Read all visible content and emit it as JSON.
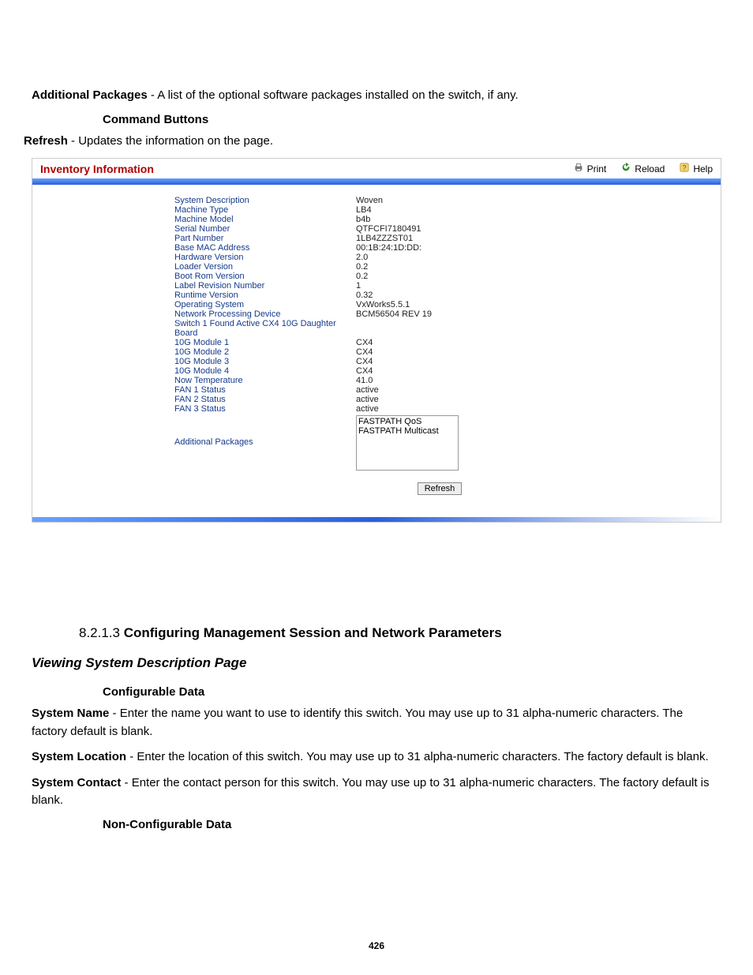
{
  "intro": {
    "additional_packages_bold": "Additional Packages",
    "additional_packages_text": " - A list of the optional software packages installed on the switch, if any.",
    "command_buttons": "Command Buttons",
    "refresh_bold": "Refresh",
    "refresh_text": " - Updates the information on the page."
  },
  "panel": {
    "title": "Inventory Information",
    "actions": {
      "print": "Print",
      "reload": "Reload",
      "help": "Help"
    },
    "rows": [
      {
        "label": "System Description",
        "value": "Woven"
      },
      {
        "label": "Machine Type",
        "value": "LB4"
      },
      {
        "label": "Machine Model",
        "value": "b4b"
      },
      {
        "label": "Serial Number",
        "value": "QTFCFI7180491"
      },
      {
        "label": "Part Number",
        "value": "1LB4ZZZST01"
      },
      {
        "label": "Base MAC Address",
        "value": "00:1B:24:1D:DD:"
      },
      {
        "label": "Hardware Version",
        "value": "2.0"
      },
      {
        "label": "Loader Version",
        "value": "0.2"
      },
      {
        "label": "Boot Rom Version",
        "value": "0.2"
      },
      {
        "label": "Label Revision Number",
        "value": "1"
      },
      {
        "label": "Runtime Version",
        "value": "0.32"
      },
      {
        "label": "Operating System",
        "value": "VxWorks5.5.1"
      },
      {
        "label": "Network Processing Device",
        "value": "BCM56504 REV 19"
      },
      {
        "label": "Switch 1 Found Active CX4 10G Daughter Board",
        "value": ""
      },
      {
        "label": "10G Module 1",
        "value": "CX4"
      },
      {
        "label": "10G Module 2",
        "value": "CX4"
      },
      {
        "label": "10G Module 3",
        "value": "CX4"
      },
      {
        "label": "10G Module 4",
        "value": "CX4"
      },
      {
        "label": "Now Temperature",
        "value": "41.0"
      },
      {
        "label": "FAN 1 Status",
        "value": "active"
      },
      {
        "label": "FAN 2 Status",
        "value": "active"
      },
      {
        "label": "FAN 3 Status",
        "value": "active"
      }
    ],
    "additional_packages_label": "Additional Packages",
    "additional_packages_value": "FASTPATH QoS\nFASTPATH Multicast",
    "refresh_button": "Refresh"
  },
  "lower": {
    "section_number": "8.2.1.3 ",
    "section_title": "Configuring Management Session and Network Parameters",
    "subheading": "Viewing System Description Page",
    "configurable_data": "Configurable Data",
    "system_name_bold": "System Name",
    "system_name_text": " - Enter the name you want to use to identify this switch. You may use up to 31 alpha-numeric characters. The factory default is blank.",
    "system_location_bold": "System Location",
    "system_location_text": " - Enter the location of this switch. You may use up to 31 alpha-numeric characters. The factory default is blank.",
    "system_contact_bold": "System Contact",
    "system_contact_text": " - Enter the contact person for this switch. You may use up to 31 alpha-numeric characters. The factory default is blank.",
    "non_configurable_data": "Non-Configurable Data"
  },
  "page_number": "426"
}
